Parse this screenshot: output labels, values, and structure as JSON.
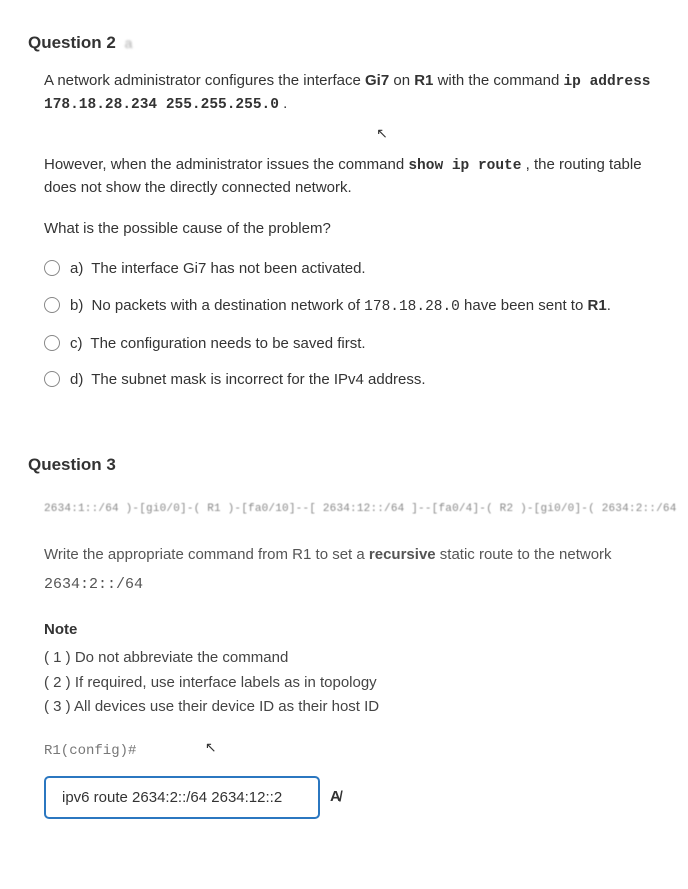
{
  "q2": {
    "title": "Question 2",
    "title_suffix": "a",
    "intro_prefix": "A network administrator configures the interface ",
    "iface": "Gi7",
    "intro_mid": " on ",
    "router": "R1",
    "intro_tail": " with the command ",
    "cmd1": "ip address 178.18.28.234 255.255.255.0",
    "period1": " .",
    "however_prefix": "However, when the administrator issues the command ",
    "cmd2": "show ip route",
    "however_tail": " , the routing table does not show the directly connected network.",
    "prompt": "What is the possible cause of the problem?",
    "options": [
      {
        "label": "a)",
        "text": "The interface Gi7 has not been activated."
      },
      {
        "label": "b)",
        "pre": "No packets with a destination network of ",
        "code": "178.18.28.0",
        "post": " have been sent to ",
        "bold_tail": "R1",
        "tail": "."
      },
      {
        "label": "c)",
        "text": "The configuration needs to be saved first."
      },
      {
        "label": "d)",
        "text": "The subnet mask is incorrect for the IPv4 address."
      }
    ]
  },
  "q3": {
    "title": "Question 3",
    "topology": "2634:1::/64 )-[gi0/0]-( R1 )-[fa0/10]--[ 2634:12::/64 ]--[fa0/4]-( R2 )-[gi0/0]-( 2634:2::/64",
    "instr_pre": "Write the appropriate command from ",
    "instr_r1": "R1",
    "instr_mid": " to set a ",
    "instr_recursive": "recursive",
    "instr_tail": " static route to the network",
    "net": "2634:2::/64",
    "note_title": "Note",
    "notes": [
      "( 1 ) Do not abbreviate the command",
      "( 2 ) If required, use interface labels as in topology",
      "( 3 ) All devices use their device ID as their host ID"
    ],
    "prompt": "R1(config)#",
    "answer": "ipv6 route 2634:2::/64 2634:12::2"
  },
  "icons": {
    "cursor": "⇱",
    "spellcheck": "A̸"
  }
}
